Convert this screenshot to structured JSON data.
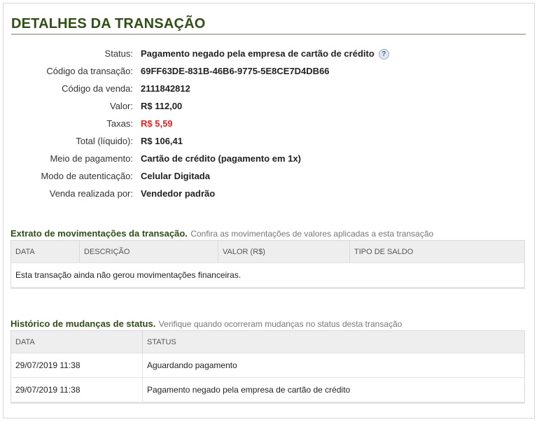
{
  "page": {
    "title": "DETALHES DA TRANSAÇÃO"
  },
  "details": [
    {
      "label": "Status:",
      "value": "Pagamento negado pela empresa de cartão de crédito",
      "help": "?"
    },
    {
      "label": "Código da transação:",
      "value": "69FF63DE-831B-46B6-9775-5E8CE7D4DB66"
    },
    {
      "label": "Código da venda:",
      "value": "2111842812"
    },
    {
      "label": "Valor:",
      "value": "R$ 112,00"
    },
    {
      "label": "Taxas:",
      "value": "R$ 5,59",
      "color": "#e8231f"
    },
    {
      "label": "Total (líquido):",
      "value": "R$ 106,41"
    },
    {
      "label": "Meio de pagamento:",
      "value": "Cartão de crédito (pagamento em 1x)"
    },
    {
      "label": "Modo de autenticação:",
      "value": "Celular Digitada"
    },
    {
      "label": "Venda realizada por:",
      "value": "Vendedor padrão"
    }
  ],
  "extrato": {
    "title": "Extrato de movimentações da transação.",
    "subtitle": "Confira as movimentações de valores aplicadas a esta transação",
    "columns": [
      "DATA",
      "DESCRIÇÃO",
      "VALOR (R$)",
      "TIPO DE SALDO"
    ],
    "empty_message": "Esta transação ainda não gerou movimentações financeiras."
  },
  "historico": {
    "title": "Histórico de mudanças de status.",
    "subtitle": "Verifique quando ocorreram mudanças no status desta transação",
    "columns": [
      "DATA",
      "STATUS"
    ],
    "rows": [
      {
        "date": "29/07/2019 11:38",
        "status": "Aguardando pagamento"
      },
      {
        "date": "29/07/2019 11:38",
        "status": "Pagamento negado pela empresa de cartão de crédito"
      }
    ]
  },
  "colors": {
    "heading": "#2f4f14",
    "negative": "#e8231f",
    "header_bg": "#eeeeee"
  }
}
